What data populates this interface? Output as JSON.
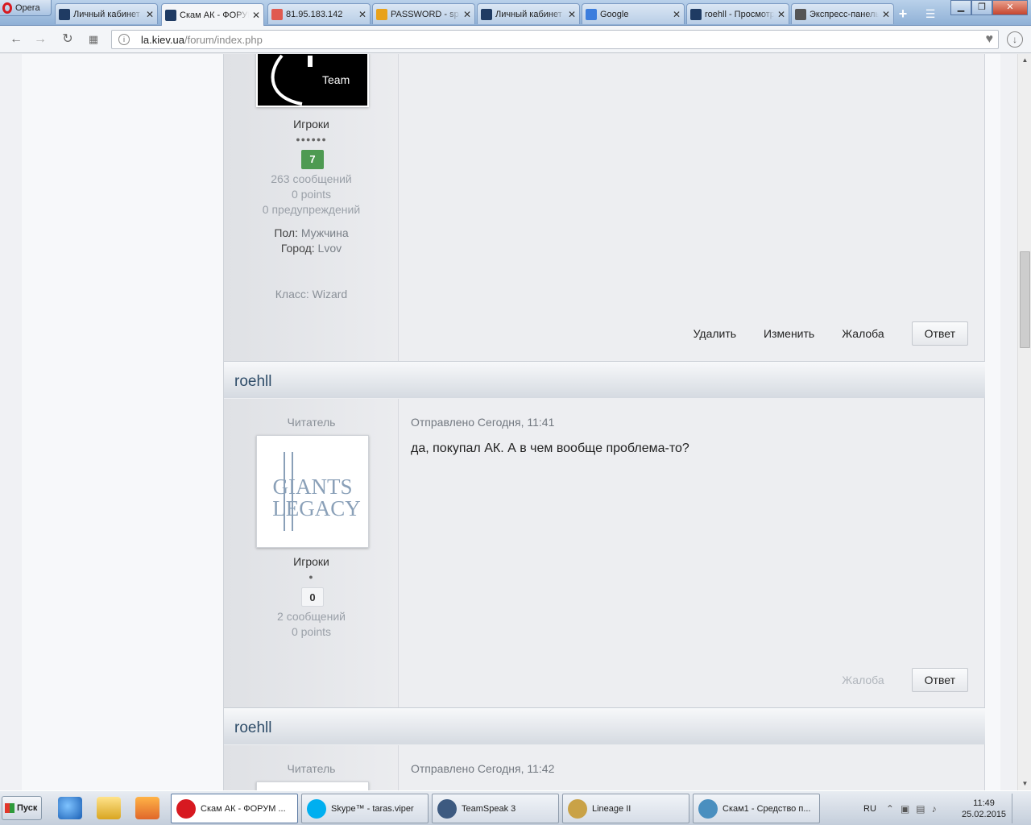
{
  "browser": {
    "app_label": "Opera",
    "tabs": [
      {
        "title": "Личный кабинет",
        "favicon": "site-icon",
        "color": "#1f3b63"
      },
      {
        "title": "Скам АК - ФОРУМ",
        "favicon": "site-icon",
        "color": "#1f3b63"
      },
      {
        "title": "81.95.183.142",
        "favicon": "page-icon",
        "color": "#e05a4f"
      },
      {
        "title": "PASSWORD - sp",
        "favicon": "password-icon",
        "color": "#e8a21b"
      },
      {
        "title": "Личный кабинет",
        "favicon": "site-icon",
        "color": "#1f3b63"
      },
      {
        "title": "Google",
        "favicon": "google-icon",
        "color": "#3b7ddd"
      },
      {
        "title": "roehll - Просмотр",
        "favicon": "site-icon",
        "color": "#1f3b63"
      },
      {
        "title": "Экспресс-панель",
        "favicon": "grid-icon",
        "color": "#555555"
      }
    ],
    "tab_close_glyph": "✕",
    "new_tab_glyph": "+",
    "url_host": "la.kiev.ua",
    "url_path": "/forum/index.php",
    "window_controls": [
      "▁",
      "❐",
      "✕"
    ]
  },
  "posts": [
    {
      "group": "Игроки",
      "pips": "●●●●●●",
      "reputation": "7",
      "posts_count": "263 сообщений",
      "points": "0 points",
      "warnings": "0 предупреждений",
      "gender_label": "Пол:",
      "gender_value": "Мужчина",
      "city_label": "Город:",
      "city_value": "Lvov",
      "class_label": "Класс:",
      "class_value": "Wizard",
      "avatar_text": "Team",
      "actions": {
        "delete": "Удалить",
        "edit": "Изменить",
        "report": "Жалоба",
        "reply": "Ответ"
      }
    },
    {
      "author": "roehll",
      "rank": "Читатель",
      "posted": "Отправлено Сегодня, 11:41",
      "message": "да, покупал АК. А в чем вообще проблема-то?",
      "avatar_line1": "GIANTS",
      "avatar_line2": "LEGACY",
      "group": "Игроки",
      "pips": "●",
      "reputation": "0",
      "posts_count": "2 сообщений",
      "points": "0 points",
      "actions": {
        "report": "Жалоба",
        "reply": "Ответ"
      }
    },
    {
      "author": "roehll",
      "rank": "Читатель",
      "posted": "Отправлено Сегодня, 11:42"
    }
  ],
  "taskbar": {
    "start": "Пуск",
    "tasks": [
      {
        "label": "Скам АК - ФОРУМ ...",
        "color": "#d71920"
      },
      {
        "label": "Skype™ - taras.viper",
        "color": "#00aff0"
      },
      {
        "label": "TeamSpeak 3",
        "color": "#3d5a80"
      },
      {
        "label": "Lineage II",
        "color": "#c9a247"
      },
      {
        "label": "Скам1 - Средство п...",
        "color": "#4a8fbf"
      }
    ],
    "lang": "RU",
    "time": "11:49",
    "date": "25.02.2015"
  }
}
